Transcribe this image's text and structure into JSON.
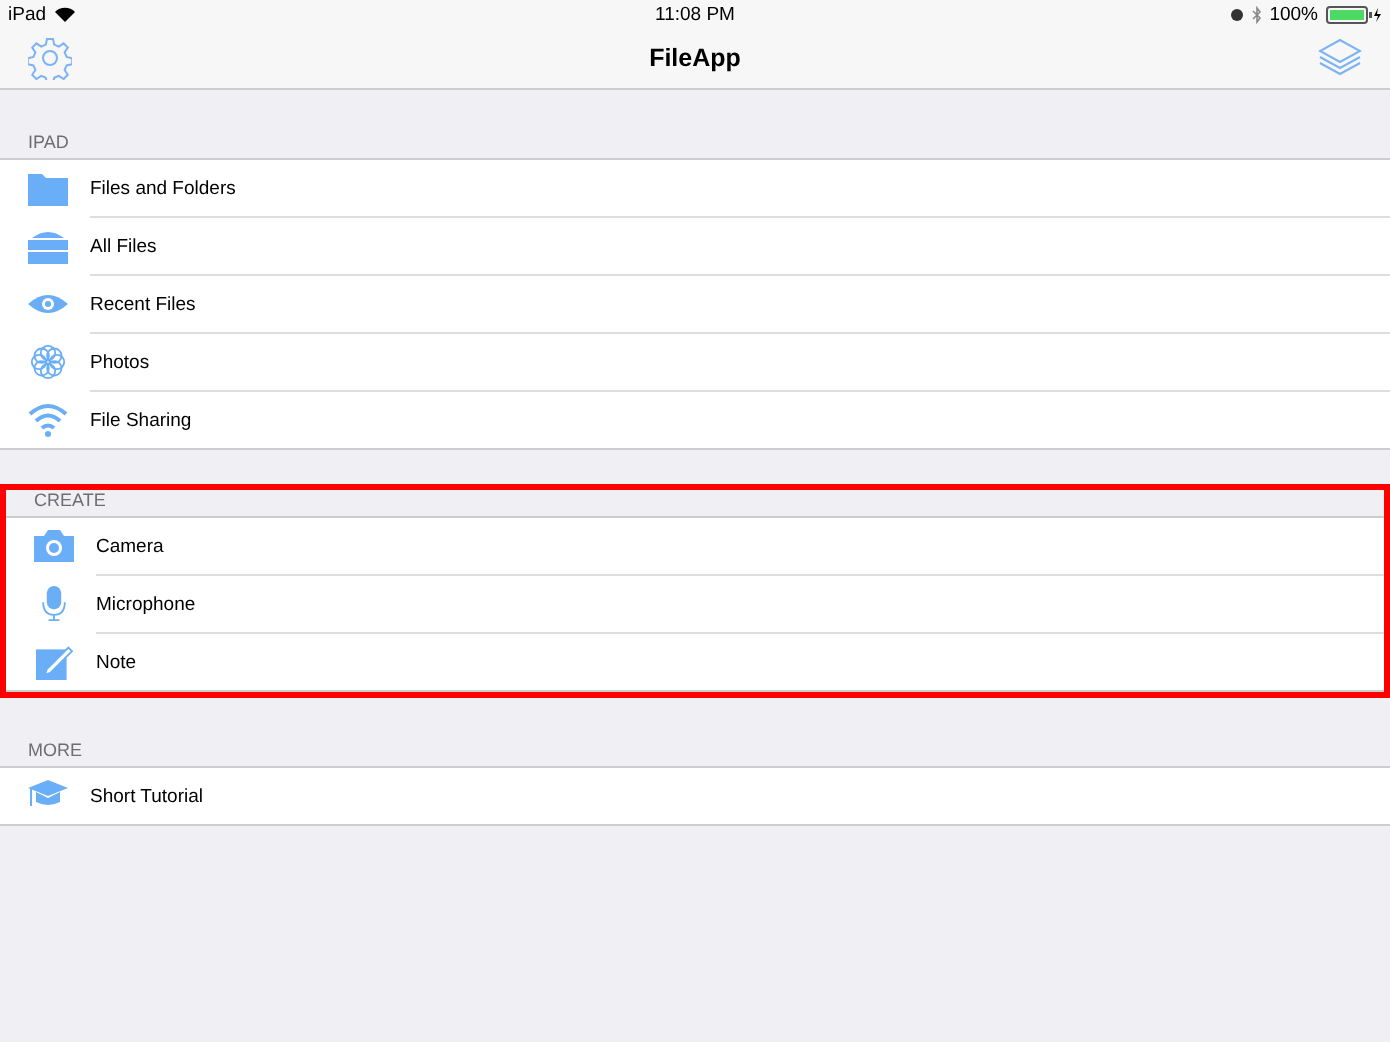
{
  "status_bar": {
    "device": "iPad",
    "time": "11:08 PM",
    "battery": "100%"
  },
  "nav": {
    "title": "FileApp"
  },
  "sections": [
    {
      "header": "IPAD",
      "highlighted": false,
      "items": [
        {
          "label": "Files and Folders",
          "kind": "folder"
        },
        {
          "label": "All Files",
          "kind": "archive"
        },
        {
          "label": "Recent Files",
          "kind": "eye"
        },
        {
          "label": "Photos",
          "kind": "flower"
        },
        {
          "label": "File Sharing",
          "kind": "wifi"
        }
      ]
    },
    {
      "header": "CREATE",
      "highlighted": true,
      "items": [
        {
          "label": "Camera",
          "kind": "camera"
        },
        {
          "label": "Microphone",
          "kind": "mic"
        },
        {
          "label": "Note",
          "kind": "note"
        }
      ]
    },
    {
      "header": "MORE",
      "highlighted": false,
      "items": [
        {
          "label": "Short Tutorial",
          "kind": "cap"
        }
      ]
    }
  ]
}
